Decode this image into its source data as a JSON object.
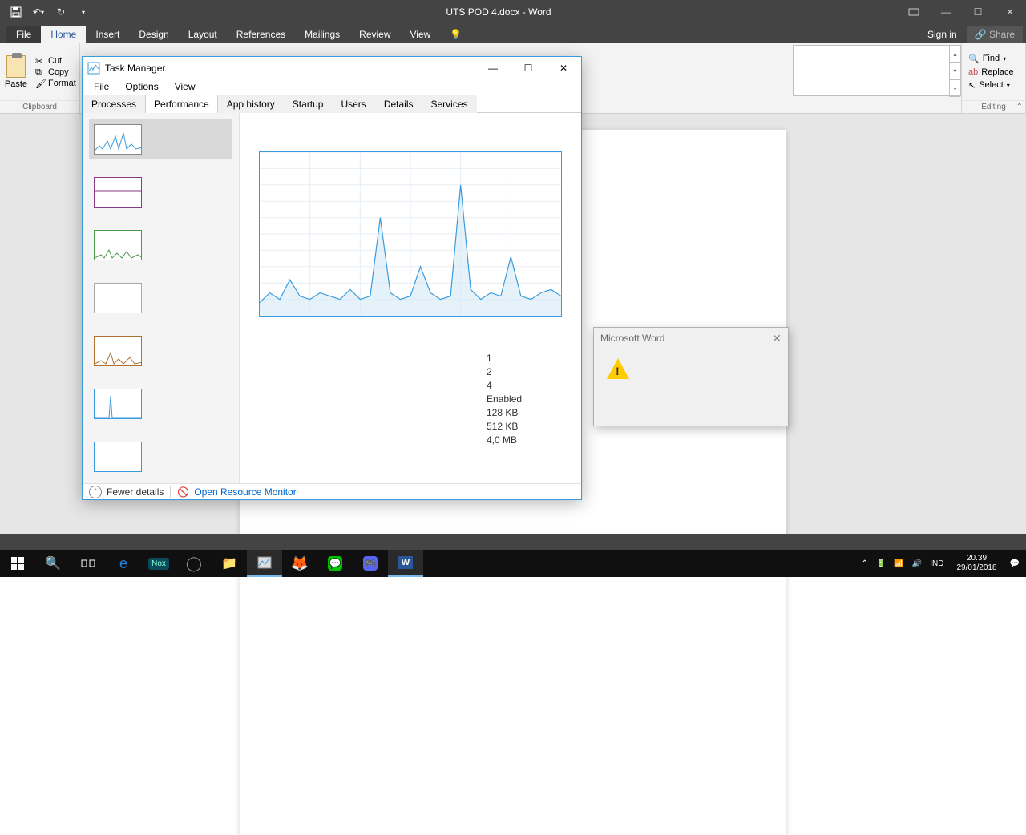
{
  "word": {
    "title": "UTS POD 4.docx - Word",
    "tabs": {
      "file": "File",
      "home": "Home",
      "insert": "Insert",
      "design": "Design",
      "layout": "Layout",
      "references": "References",
      "mailings": "Mailings",
      "review": "Review",
      "view": "View"
    },
    "signin": "Sign in",
    "share": "Share",
    "clipboard": {
      "paste": "Paste",
      "cut": "Cut",
      "copy": "Copy",
      "format": "Format",
      "label": "Clipboard"
    },
    "editing": {
      "find": "Find",
      "replace": "Replace",
      "select": "Select",
      "label": "Editing"
    },
    "statusbar": "",
    "dialog_title": "Microsoft Word"
  },
  "taskmgr": {
    "title": "Task Manager",
    "menu": {
      "file": "File",
      "options": "Options",
      "view": "View"
    },
    "tabs": {
      "processes": "Processes",
      "performance": "Performance",
      "app_history": "App history",
      "startup": "Startup",
      "users": "Users",
      "details": "Details",
      "services": "Services"
    },
    "stats": {
      "sockets": "1",
      "cores": "2",
      "logical": "4",
      "virt": "Enabled",
      "l1": "128 KB",
      "l2": "512 KB",
      "l3": "4,0 MB"
    },
    "fewer": "Fewer details",
    "orm": "Open Resource Monitor"
  },
  "taskbar": {
    "lang": "IND",
    "time": "20.39",
    "date": "29/01/2018"
  },
  "chart_data": {
    "type": "line",
    "title": "",
    "xlabel": "",
    "ylabel": "",
    "xlim": [
      0,
      60
    ],
    "ylim": [
      0,
      100
    ],
    "x": [
      0,
      2,
      4,
      6,
      8,
      10,
      12,
      14,
      16,
      18,
      20,
      22,
      24,
      26,
      28,
      30,
      32,
      34,
      36,
      38,
      40,
      42,
      44,
      46,
      48,
      50,
      52,
      54,
      56,
      58,
      60
    ],
    "values": [
      8,
      14,
      10,
      22,
      12,
      10,
      14,
      12,
      10,
      16,
      10,
      12,
      60,
      14,
      10,
      12,
      30,
      14,
      10,
      12,
      80,
      16,
      10,
      14,
      12,
      36,
      12,
      10,
      14,
      16,
      12
    ]
  }
}
